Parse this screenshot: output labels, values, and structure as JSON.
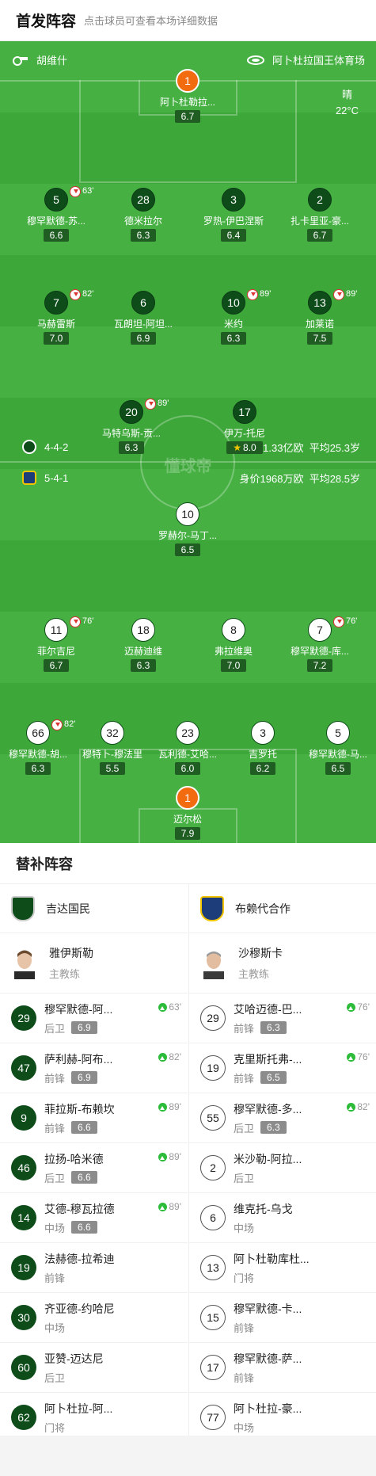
{
  "header": {
    "title": "首发阵容",
    "subtitle": "点击球员可查看本场详细数据"
  },
  "pitch": {
    "referee": "胡维什",
    "venue": "阿卜杜拉国王体育场",
    "weather": "晴",
    "temperature": "22°C",
    "watermark": "懂球帝",
    "home_team": {
      "formation": "4-4-2",
      "value": "身价1.33亿欧",
      "age": "平均25.3岁",
      "color": "#0e4d1a"
    },
    "away_team": {
      "formation": "5-4-1",
      "value": "身价1968万欧",
      "age": "平均28.5岁",
      "color": "#1d3c7a"
    }
  },
  "home_players": [
    {
      "num": "1",
      "name": "阿卜杜勒拉...",
      "rating": "6.7",
      "role": "gk"
    },
    {
      "num": "5",
      "name": "穆罕默德-苏...",
      "rating": "6.6",
      "sub": "63'"
    },
    {
      "num": "28",
      "name": "德米拉尔",
      "rating": "6.3",
      "card": "yellow"
    },
    {
      "num": "3",
      "name": "罗热-伊巴涅斯",
      "rating": "6.4",
      "card": "red"
    },
    {
      "num": "2",
      "name": "扎卡里亚-豪...",
      "rating": "6.7",
      "goal": true
    },
    {
      "num": "7",
      "name": "马赫雷斯",
      "rating": "7.0",
      "sub": "82'",
      "captain": true
    },
    {
      "num": "6",
      "name": "瓦朗坦-阿坦...",
      "rating": "6.9"
    },
    {
      "num": "10",
      "name": "米约",
      "rating": "6.3",
      "sub": "89'",
      "card": "yellow"
    },
    {
      "num": "13",
      "name": "加莱诺",
      "rating": "7.5",
      "sub": "89'"
    },
    {
      "num": "20",
      "name": "马特乌斯-贡...",
      "rating": "6.3",
      "sub": "89'"
    },
    {
      "num": "17",
      "name": "伊万-托尼",
      "rating": "8.0",
      "star": true,
      "goal": true
    }
  ],
  "away_players": [
    {
      "num": "10",
      "name": "罗赫尔-马丁...",
      "rating": "6.5",
      "card": "yellow",
      "goal": true
    },
    {
      "num": "11",
      "name": "菲尔吉尼",
      "rating": "6.7",
      "sub": "76'"
    },
    {
      "num": "18",
      "name": "迈赫迪维",
      "rating": "6.3",
      "card": "yellow",
      "captain": true
    },
    {
      "num": "8",
      "name": "弗拉维奥",
      "rating": "7.0"
    },
    {
      "num": "7",
      "name": "穆罕默德-库...",
      "rating": "7.2",
      "sub": "76'"
    },
    {
      "num": "66",
      "name": "穆罕默德-胡...",
      "rating": "6.3",
      "sub": "82'"
    },
    {
      "num": "32",
      "name": "穆特卜-穆法里",
      "rating": "5.5",
      "card": "yellow"
    },
    {
      "num": "23",
      "name": "瓦利德-艾哈...",
      "rating": "6.0",
      "card": "yellow"
    },
    {
      "num": "3",
      "name": "吉罗托",
      "rating": "6.2"
    },
    {
      "num": "5",
      "name": "穆罕默德-马...",
      "rating": "6.5"
    },
    {
      "num": "1",
      "name": "迈尔松",
      "rating": "7.9",
      "role": "gk"
    }
  ],
  "subs_section": {
    "title": "替补阵容"
  },
  "home_subs": {
    "team": "吉达国民",
    "coach": {
      "name": "雅伊斯勒",
      "role": "主教练"
    },
    "players": [
      {
        "num": "29",
        "name": "穆罕默德-阿...",
        "pos": "后卫",
        "rating": "6.9",
        "min": "63'"
      },
      {
        "num": "47",
        "name": "萨利赫-阿布...",
        "pos": "前锋",
        "rating": "6.9",
        "min": "82'"
      },
      {
        "num": "9",
        "name": "菲拉斯-布赖坎",
        "pos": "前锋",
        "rating": "6.6",
        "min": "89'"
      },
      {
        "num": "46",
        "name": "拉扬-哈米德",
        "pos": "后卫",
        "rating": "6.6",
        "min": "89'"
      },
      {
        "num": "14",
        "name": "艾德-穆瓦拉德",
        "pos": "中场",
        "rating": "6.6",
        "min": "89'"
      },
      {
        "num": "19",
        "name": "法赫德-拉希迪",
        "pos": "前锋"
      },
      {
        "num": "30",
        "name": "齐亚德-约哈尼",
        "pos": "中场"
      },
      {
        "num": "60",
        "name": "亚赞-迈达尼",
        "pos": "后卫"
      },
      {
        "num": "62",
        "name": "阿卜杜拉-阿...",
        "pos": "门将"
      }
    ]
  },
  "away_subs": {
    "team": "布赖代合作",
    "coach": {
      "name": "沙穆斯卡",
      "role": "主教练"
    },
    "players": [
      {
        "num": "29",
        "name": "艾哈迈德-巴...",
        "pos": "前锋",
        "rating": "6.3",
        "min": "76'"
      },
      {
        "num": "19",
        "name": "克里斯托弗-...",
        "pos": "前锋",
        "rating": "6.5",
        "min": "76'"
      },
      {
        "num": "55",
        "name": "穆罕默德-多...",
        "pos": "后卫",
        "rating": "6.3",
        "min": "82'"
      },
      {
        "num": "2",
        "name": "米沙勒-阿拉...",
        "pos": "后卫"
      },
      {
        "num": "6",
        "name": "维克托-乌戈",
        "pos": "中场"
      },
      {
        "num": "13",
        "name": "阿卜杜勒库杜...",
        "pos": "门将"
      },
      {
        "num": "15",
        "name": "穆罕默德-卡...",
        "pos": "前锋"
      },
      {
        "num": "17",
        "name": "穆罕默德-萨...",
        "pos": "前锋"
      },
      {
        "num": "77",
        "name": "阿卜杜拉-豪...",
        "pos": "中场"
      }
    ]
  }
}
